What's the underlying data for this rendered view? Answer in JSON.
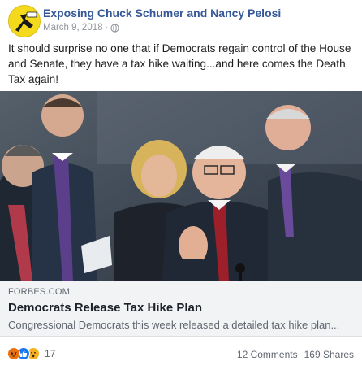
{
  "post": {
    "page_name": "Exposing Chuck Schumer and Nancy Pelosi",
    "date": "March 9, 2018",
    "separator": "·",
    "privacy_icon": "globe-icon",
    "text": "It should surprise no one that if Democrats regain control of the House and Senate, they have a tax hike waiting...and here comes the Death Tax again!"
  },
  "link": {
    "domain": "FORBES.COM",
    "title": "Democrats Release Tax Hike Plan",
    "description": "Congressional Democrats this week released a detailed tax hike plan..."
  },
  "footer": {
    "reaction_icons": [
      "angry-reaction-icon",
      "like-reaction-icon",
      "wow-reaction-icon"
    ],
    "reaction_count": "17",
    "comments": "12 Comments",
    "shares": "169 Shares"
  },
  "colors": {
    "page_name": "#365899",
    "link_background": "#f2f3f5",
    "avatar_background": "#f5d91c"
  }
}
